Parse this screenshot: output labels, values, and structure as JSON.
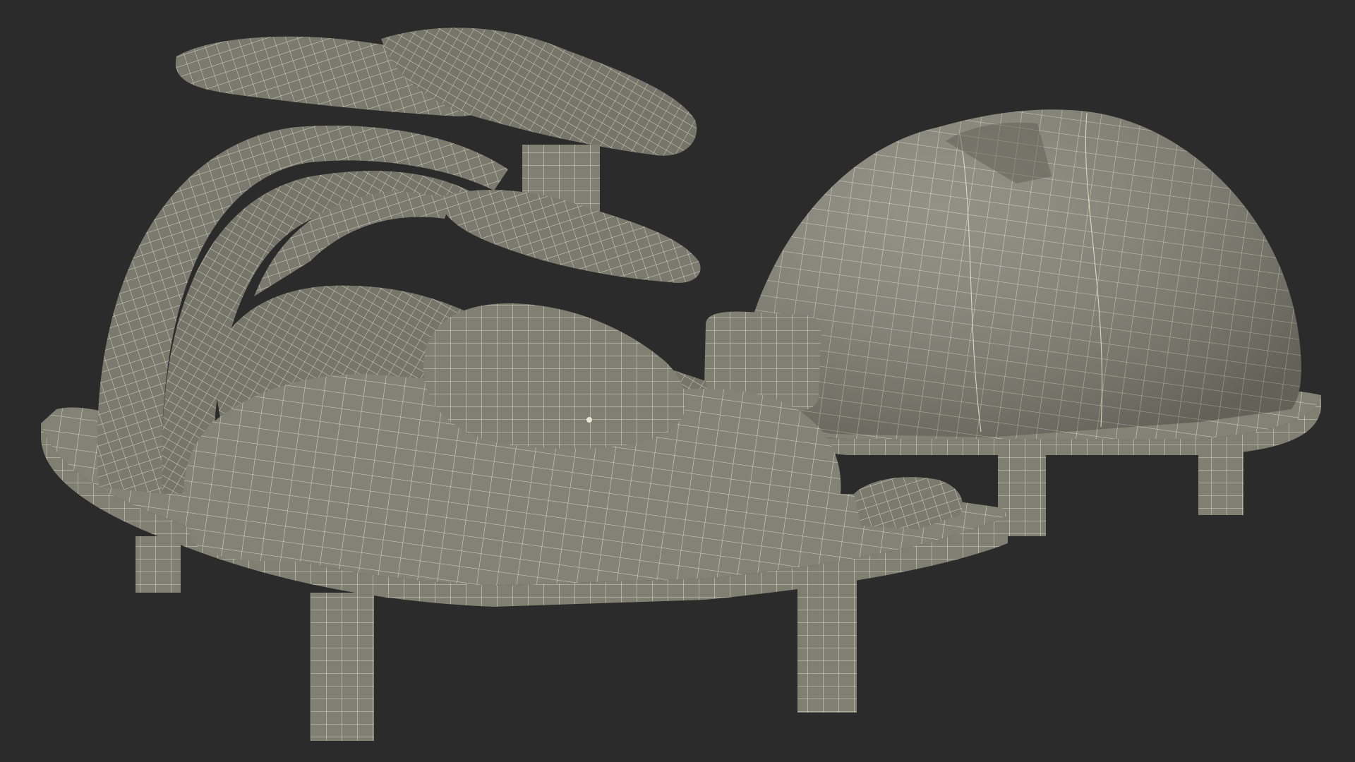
{
  "render": {
    "background_color": "#2b2b2b",
    "surface_color": "#7f7f72",
    "surface_dark_color": "#65655b",
    "surface_light_color": "#96968a",
    "wireframe_color": "#e8e6d2"
  },
  "scene": {
    "objects": [
      {
        "name": "open-base-with-organs"
      },
      {
        "name": "dome-cover"
      }
    ]
  }
}
